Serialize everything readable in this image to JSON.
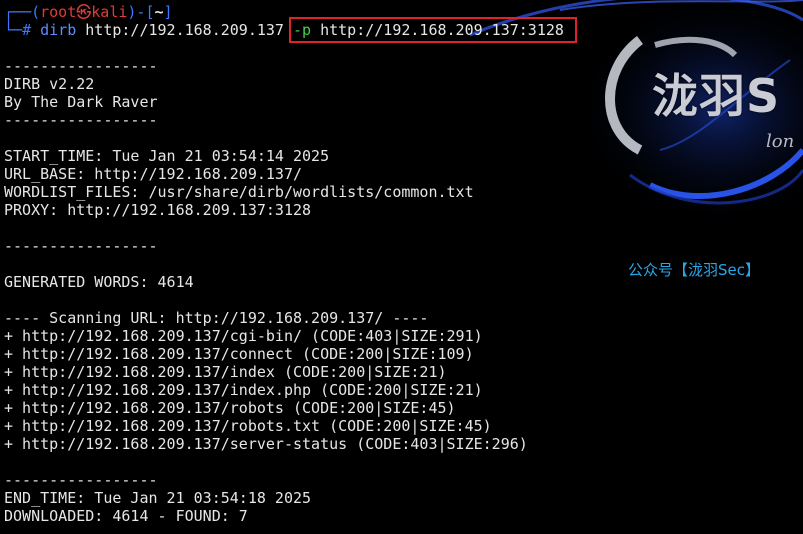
{
  "prompt": {
    "corner_top": "┌──(",
    "user": "root",
    "skull": "㉿",
    "host": "kali",
    "mid": ")-[",
    "dir": "~",
    "end": "]",
    "corner_bottom": "└─",
    "hash": "# ",
    "command": "dirb",
    "arg_target": " http://192.168.209.137 ",
    "flag": "-p",
    "arg_proxy": " http://192.168.209.137:3128 "
  },
  "output": {
    "sep1": "-----------------",
    "version": "DIRB v2.22",
    "author": "By The Dark Raver",
    "sep2": "-----------------",
    "start_time": "START_TIME: Tue Jan 21 03:54:14 2025",
    "url_base": "URL_BASE: http://192.168.209.137/",
    "wordlist": "WORDLIST_FILES: /usr/share/dirb/wordlists/common.txt",
    "proxy": "PROXY: http://192.168.209.137:3128",
    "sep3": "-----------------",
    "generated": "GENERATED WORDS: 4614",
    "scanning": "---- Scanning URL: http://192.168.209.137/ ----",
    "results": [
      "+ http://192.168.209.137/cgi-bin/ (CODE:403|SIZE:291)",
      "+ http://192.168.209.137/connect (CODE:200|SIZE:109)",
      "+ http://192.168.209.137/index (CODE:200|SIZE:21)",
      "+ http://192.168.209.137/index.php (CODE:200|SIZE:21)",
      "+ http://192.168.209.137/robots (CODE:200|SIZE:45)",
      "+ http://192.168.209.137/robots.txt (CODE:200|SIZE:45)",
      "+ http://192.168.209.137/server-status (CODE:403|SIZE:296)"
    ],
    "sep4": "-----------------",
    "end_time": "END_TIME: Tue Jan 21 03:54:18 2025",
    "downloaded": "DOWNLOADED: 4614 - FOUND: 7"
  },
  "watermark": {
    "logo_text": "泷羽S",
    "logo_sub": "lon",
    "account": "公众号【泷羽Sec】"
  },
  "colors": {
    "background": "#000000",
    "prompt_blue": "#3b78ff",
    "prompt_red": "#e03a3a",
    "flag_green": "#44d04a",
    "highlight_box": "#e0232a",
    "watermark_blue": "#2aa7e8"
  }
}
